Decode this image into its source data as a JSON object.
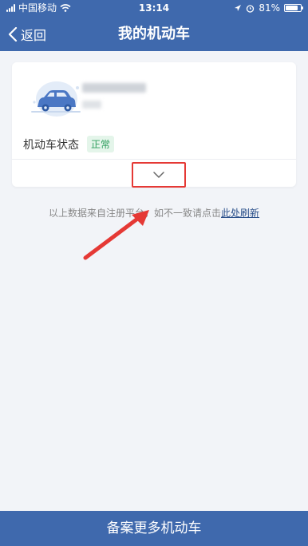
{
  "status_bar": {
    "carrier": "中国移动",
    "time": "13:14",
    "battery_text": "81%",
    "battery_level": 0.81
  },
  "nav": {
    "back_label": "返回",
    "title": "我的机动车"
  },
  "card": {
    "status_label": "机动车状态",
    "status_value": "正常",
    "expand_icon": "chevron-down-icon"
  },
  "hint": {
    "text": "以上数据来自注册平台，如不一致请点击",
    "link": "此处刷新"
  },
  "bottom": {
    "label": "备案更多机动车"
  },
  "colors": {
    "primary": "#3f69ad",
    "status_green": "#2f9e5e",
    "annotation_red": "#e53935",
    "background": "#f2f4f8"
  }
}
